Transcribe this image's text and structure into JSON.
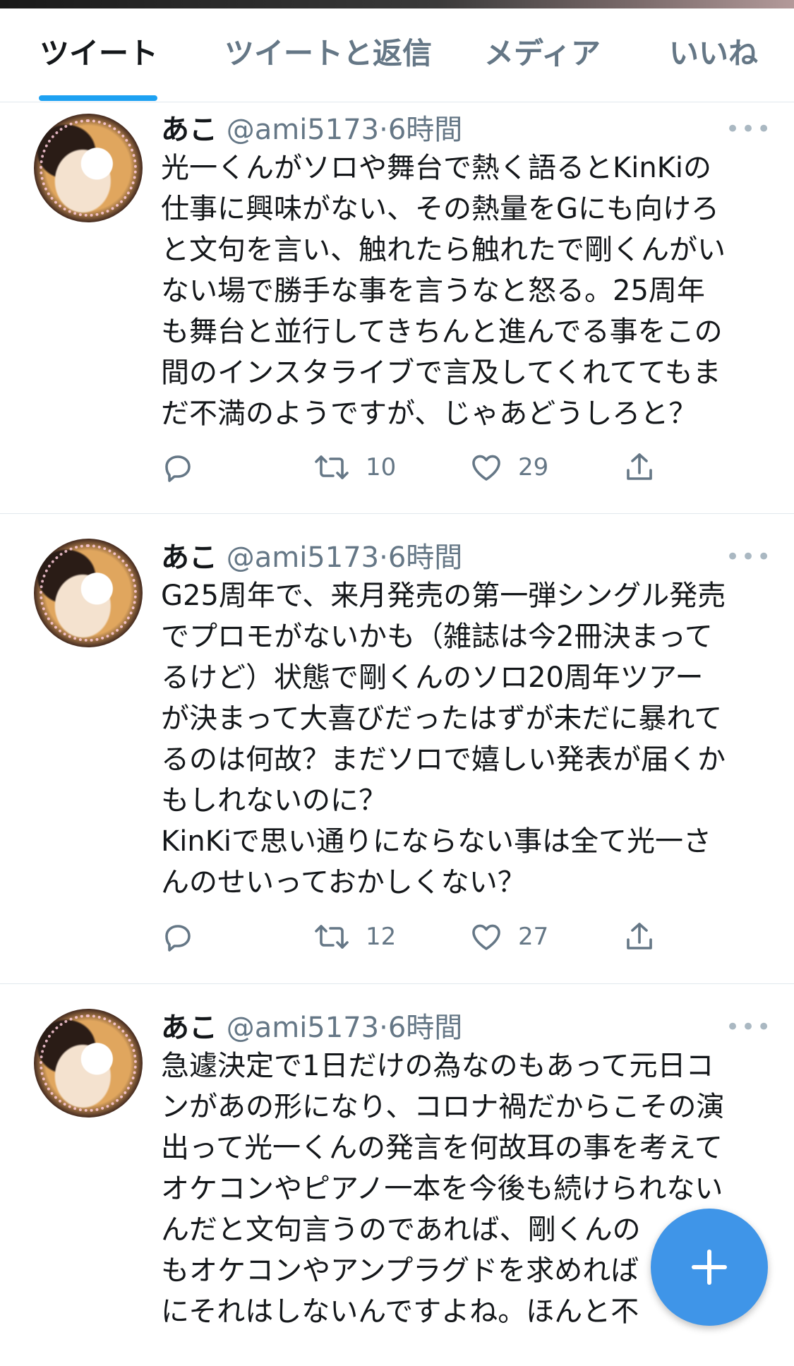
{
  "tabs": [
    {
      "label": "ツイート"
    },
    {
      "label": "ツイートと返信"
    },
    {
      "label": "メディア"
    },
    {
      "label": "いいね"
    }
  ],
  "tweets": [
    {
      "name": "あこ",
      "handle": "@ami5173",
      "separator": "·",
      "time": "6時間",
      "lines": [
        "光一くんがソロや舞台で熱く語るとKinKiの",
        "仕事に興味がない、その熱量をGにも向けろ",
        "と文句を言い、触れたら触れたで剛くんがい",
        "ない場で勝手な事を言うなと怒る。25周年",
        "も舞台と並行してきちんと進んでる事をこの",
        "間のインスタライブで言及してくれててもま",
        "だ不満のようですが、じゃあどうしろと？"
      ],
      "retweets": "10",
      "likes": "29"
    },
    {
      "name": "あこ",
      "handle": "@ami5173",
      "separator": "·",
      "time": "6時間",
      "lines": [
        "G25周年で、来月発売の第一弾シングル発売",
        "でプロモがないかも（雑誌は今2冊決まって",
        "るけど）状態で剛くんのソロ20周年ツアー",
        "が決まって大喜びだったはずが未だに暴れて",
        "るのは何故？まだソロで嬉しい発表が届くか",
        "もしれないのに？",
        "KinKiで思い通りにならない事は全て光一さ",
        "んのせいっておかしくない？"
      ],
      "retweets": "12",
      "likes": "27"
    },
    {
      "name": "あこ",
      "handle": "@ami5173",
      "separator": "·",
      "time": "6時間",
      "lines": [
        "急遽決定で1日だけの為なのもあって元日コ",
        "ンがあの形になり、コロナ禍だからこその演",
        "出って光一くんの発言を何故耳の事を考えて",
        "オケコンやピアノ一本を今後も続けられない",
        "んだと文句言うのであれば、剛くんの",
        "もオケコンやアンプラグドを求めれば",
        "にそれはしないんですよね。ほんと不"
      ]
    }
  ],
  "colors": {
    "accent": "#1da1f2",
    "fab": "#3f95e8",
    "secondary_text": "#657786"
  },
  "icons": [
    "reply-icon",
    "retweet-icon",
    "like-icon",
    "share-icon",
    "more-icon",
    "compose-plus-icon"
  ]
}
